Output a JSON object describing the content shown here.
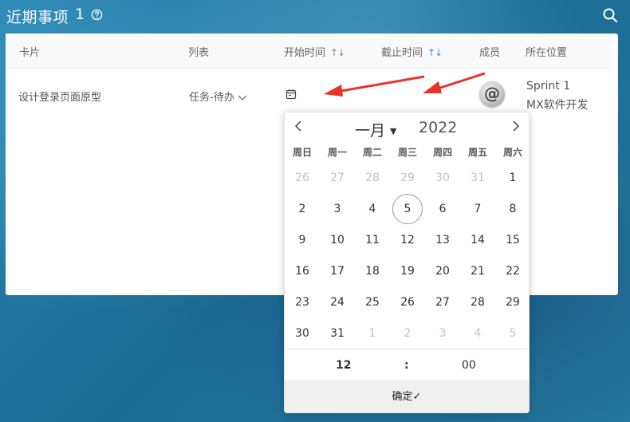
{
  "header": {
    "title": "近期事项",
    "count": "1"
  },
  "table": {
    "columns": [
      "卡片",
      "列表",
      "开始时间",
      "截止时间",
      "成员",
      "所在位置"
    ],
    "sort_glyph": "↑↓",
    "row": {
      "card": "设计登录页面原型",
      "list": "任务-待办",
      "avatar_glyph": "@",
      "location_line1": "Sprint 1",
      "location_line2": "MX软件开发"
    }
  },
  "picker": {
    "month": "一月",
    "year": "2022",
    "weekdays": [
      "周日",
      "周一",
      "周二",
      "周三",
      "周四",
      "周五",
      "周六"
    ],
    "days": [
      [
        "26",
        "27",
        "28",
        "29",
        "30",
        "31",
        "1"
      ],
      [
        "2",
        "3",
        "4",
        "5",
        "6",
        "7",
        "8"
      ],
      [
        "9",
        "10",
        "11",
        "12",
        "13",
        "14",
        "15"
      ],
      [
        "16",
        "17",
        "18",
        "19",
        "20",
        "21",
        "22"
      ],
      [
        "23",
        "24",
        "25",
        "26",
        "27",
        "28",
        "29"
      ],
      [
        "30",
        "31",
        "1",
        "2",
        "3",
        "4",
        "5"
      ]
    ],
    "muted": [
      [
        true,
        true,
        true,
        true,
        true,
        true,
        false
      ],
      [
        false,
        false,
        false,
        false,
        false,
        false,
        false
      ],
      [
        false,
        false,
        false,
        false,
        false,
        false,
        false
      ],
      [
        false,
        false,
        false,
        false,
        false,
        false,
        false
      ],
      [
        false,
        false,
        false,
        false,
        false,
        false,
        false
      ],
      [
        false,
        false,
        true,
        true,
        true,
        true,
        true
      ]
    ],
    "today": "5",
    "hour": "12",
    "separator": ":",
    "minute": "00",
    "confirm_label": "确定",
    "confirm_glyph": "✓"
  },
  "colors": {
    "accent": "#3a8ee6",
    "arrow": "#e8322a"
  }
}
